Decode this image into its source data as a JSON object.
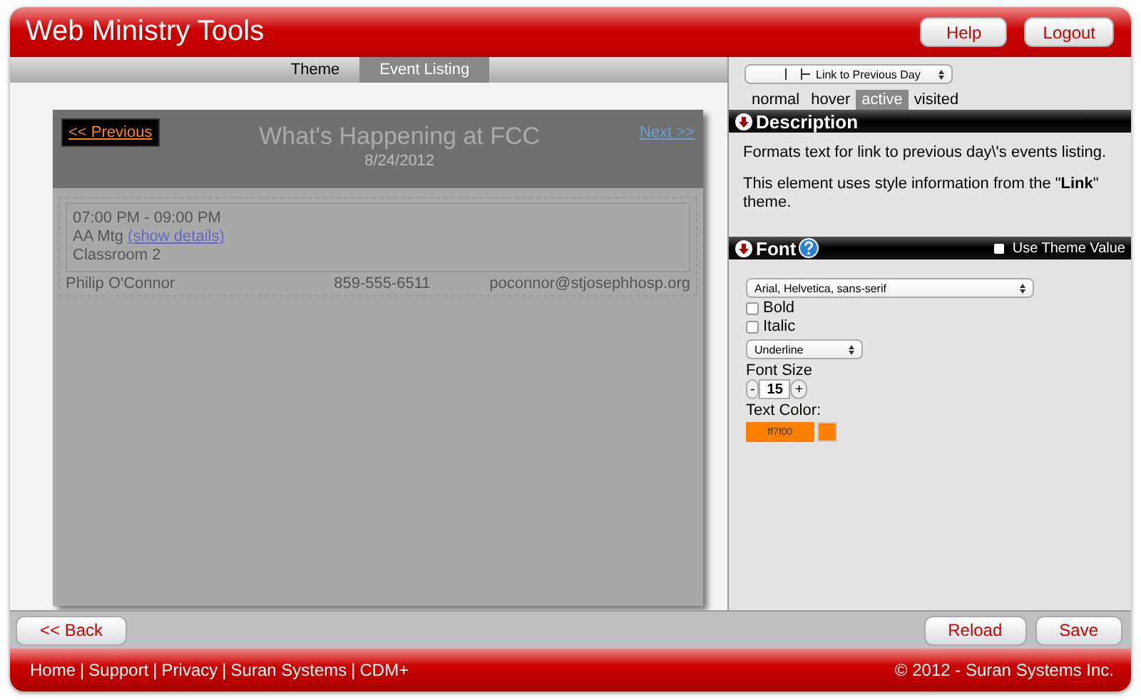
{
  "header": {
    "title": "Web Ministry Tools",
    "buttons": [
      "Help",
      "Logout"
    ]
  },
  "tabs": [
    {
      "label": "Theme",
      "selected": false
    },
    {
      "label": "Event Listing",
      "selected": true
    }
  ],
  "preview": {
    "prev_link": "<< Previous",
    "next_link": "Next >>",
    "title": "What's Happening at FCC",
    "date": "8/24/2012",
    "event": {
      "time": "07:00 PM - 09:00 PM",
      "name": "AA Mtg",
      "details_link": "(show details)",
      "location": "Classroom 2"
    },
    "contact": {
      "name": "Philip O'Connor",
      "phone": "859-555-6511",
      "email": "poconnor@stjosephhosp.org"
    }
  },
  "element_select": {
    "value": "Link to Previous Day"
  },
  "state_tabs": [
    {
      "label": "normal",
      "selected": false
    },
    {
      "label": "hover",
      "selected": false
    },
    {
      "label": "active",
      "selected": true
    },
    {
      "label": "visited",
      "selected": false
    }
  ],
  "description": {
    "heading": "Description",
    "text": "Formats text for link to previous day\\'s events listing.",
    "theme_note": "This element uses style information from the \"**Link**\" theme."
  },
  "font": {
    "heading": "Font",
    "use_theme_value": {
      "label": "Use Theme Value",
      "checked": false
    },
    "family": "Arial, Helvetica, sans-serif",
    "options": [
      {
        "label": "Bold",
        "checked": false
      },
      {
        "label": "Italic",
        "checked": false
      }
    ],
    "decoration": "Underline",
    "size_label": "Font Size",
    "size": "15",
    "minus": "-",
    "plus": "+",
    "color_label": "Text Color:",
    "color_value": "ff7f00",
    "color": "#ff7f00"
  },
  "bottom_bar": {
    "left_buttons": [
      "<< Back"
    ],
    "right_buttons": [
      "Reload",
      "Save"
    ]
  },
  "footer": {
    "links": [
      "Home",
      "Support",
      "Privacy",
      "Suran Systems",
      "CDM+"
    ],
    "separator": "|",
    "copyright": "© 2012 - Suran Systems Inc."
  }
}
